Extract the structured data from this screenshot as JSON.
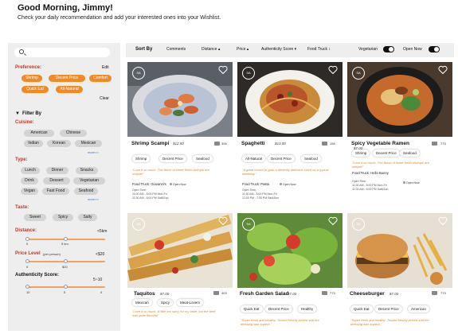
{
  "header": {
    "greeting": "Good Morning, Jimmy!",
    "subtitle": "Check your daily recommendation and add your interested ones into your Wishlist."
  },
  "sidebar": {
    "search_placeholder": "",
    "preference_label": "Preference:",
    "edit_label": "Edit",
    "preferences": [
      "Shrimp",
      "Decent Price",
      "Comfort",
      "Quick Eat",
      "All-Natural"
    ],
    "clear_label": "Clear",
    "filter_by_label": "Filter By",
    "cuisine_label": "Cuisine:",
    "cuisines": [
      "American",
      "Chinese",
      "Indian",
      "Korean",
      "Mexican"
    ],
    "more_label": "more>>",
    "type_label": "Type:",
    "types": [
      "Lunch",
      "Dinner",
      "Snacks",
      "Drink",
      "Dessert",
      "Vegetarian",
      "Vegan",
      "Fast Food",
      "Seafood"
    ],
    "taste_label": "Taste:",
    "tastes": [
      "Sweet",
      "Spicy",
      "Salty"
    ],
    "distance_label": "Distance:",
    "distance_value": "<5km",
    "distance_ticks": [
      "0",
      "5 km"
    ],
    "price_label": "Price Level",
    "price_sub": "(per person)",
    "price_value": "<$20",
    "price_ticks": [
      "0",
      "$20"
    ],
    "auth_label": "Authenticity Score:",
    "auth_value": "5~10",
    "auth_ticks": [
      "10",
      "5",
      "0"
    ]
  },
  "toolbar": {
    "sort_label": "Sort By",
    "comments": "Comments",
    "distance": "Distance ▴",
    "price": "Price ▴",
    "authenticity": "Authenticity Score ▾",
    "food_truck": "Food Truck ↕",
    "vegetarian": "Vegetarian",
    "open_now": "Open Now"
  },
  "cards": [
    {
      "name": "Shrimp Scampi",
      "price": "$12.50",
      "comments": "306",
      "tags": [
        "Shrimp",
        "Decent Price",
        "Seafood"
      ],
      "quote": "\"Love it so much. The flavor of these fresh shrimps are unique!\"",
      "truck": "Food Truck: Giovanni's",
      "open": "Open Now",
      "hours": [
        "Open Time:",
        "11:00 AM - 8:00 PM Mon-Fri",
        "11:30 AM - 6:00 PM Sat&Sun"
      ]
    },
    {
      "name": "Spaghetti",
      "price": "$13.00",
      "comments": "156",
      "tags": [
        "All-Natural",
        "Decent Price",
        "Seafood"
      ],
      "quote": "\"A great choice to grab a decently delicious lunch on a typical weekday.\"",
      "truck": "Food Truck: Pasta",
      "open": "Open Now",
      "hours": [
        "Open Time:",
        "11:00 AM - 8:00 PM Mon-Fri",
        "12:00 PM - 7:30 PM Sat&Sun"
      ]
    },
    {
      "name": "Spicy Vegetable Ramen",
      "price": "$7.00",
      "comments": "773",
      "tags": [
        "Shrimp",
        "Decent Price",
        "Seafood"
      ],
      "quote": "\"Love it so much. The flavor of these fresh shrimps are unique!\"",
      "truck": "Food Truck: Hello Bunny",
      "open": "Open Now",
      "hours": [
        "Open Time:",
        "11:00 AM - 8:00 PM Mon-Fri",
        "11:00 AM - 6:00 PM Sat&Sun"
      ]
    },
    {
      "name": "Taquitos",
      "price": "$7.00",
      "comments": "403",
      "tags": [
        "Mexican",
        "Spicy",
        "Meat-Lovers"
      ],
      "quote": "\"Love it so much. A little too spicy for my taste, but the beef was quite flavorful\""
    },
    {
      "name": "Fresh Garden Salad",
      "price": "$7.00",
      "comments": "773",
      "tags": [
        "Quick Eat",
        "Decent Price",
        "Healthy"
      ],
      "quote": "\"Super fresh and healthy. Tossed freshly picked and the dressing was superb.\""
    },
    {
      "name": "Cheeseburger",
      "price": "$7.00",
      "comments": "773",
      "tags": [
        "Quick Eat",
        "Decent Price",
        "American"
      ],
      "quote": "\"Super fresh and healthy. Tossed freshly picked and the dressing was superb.\""
    }
  ]
}
